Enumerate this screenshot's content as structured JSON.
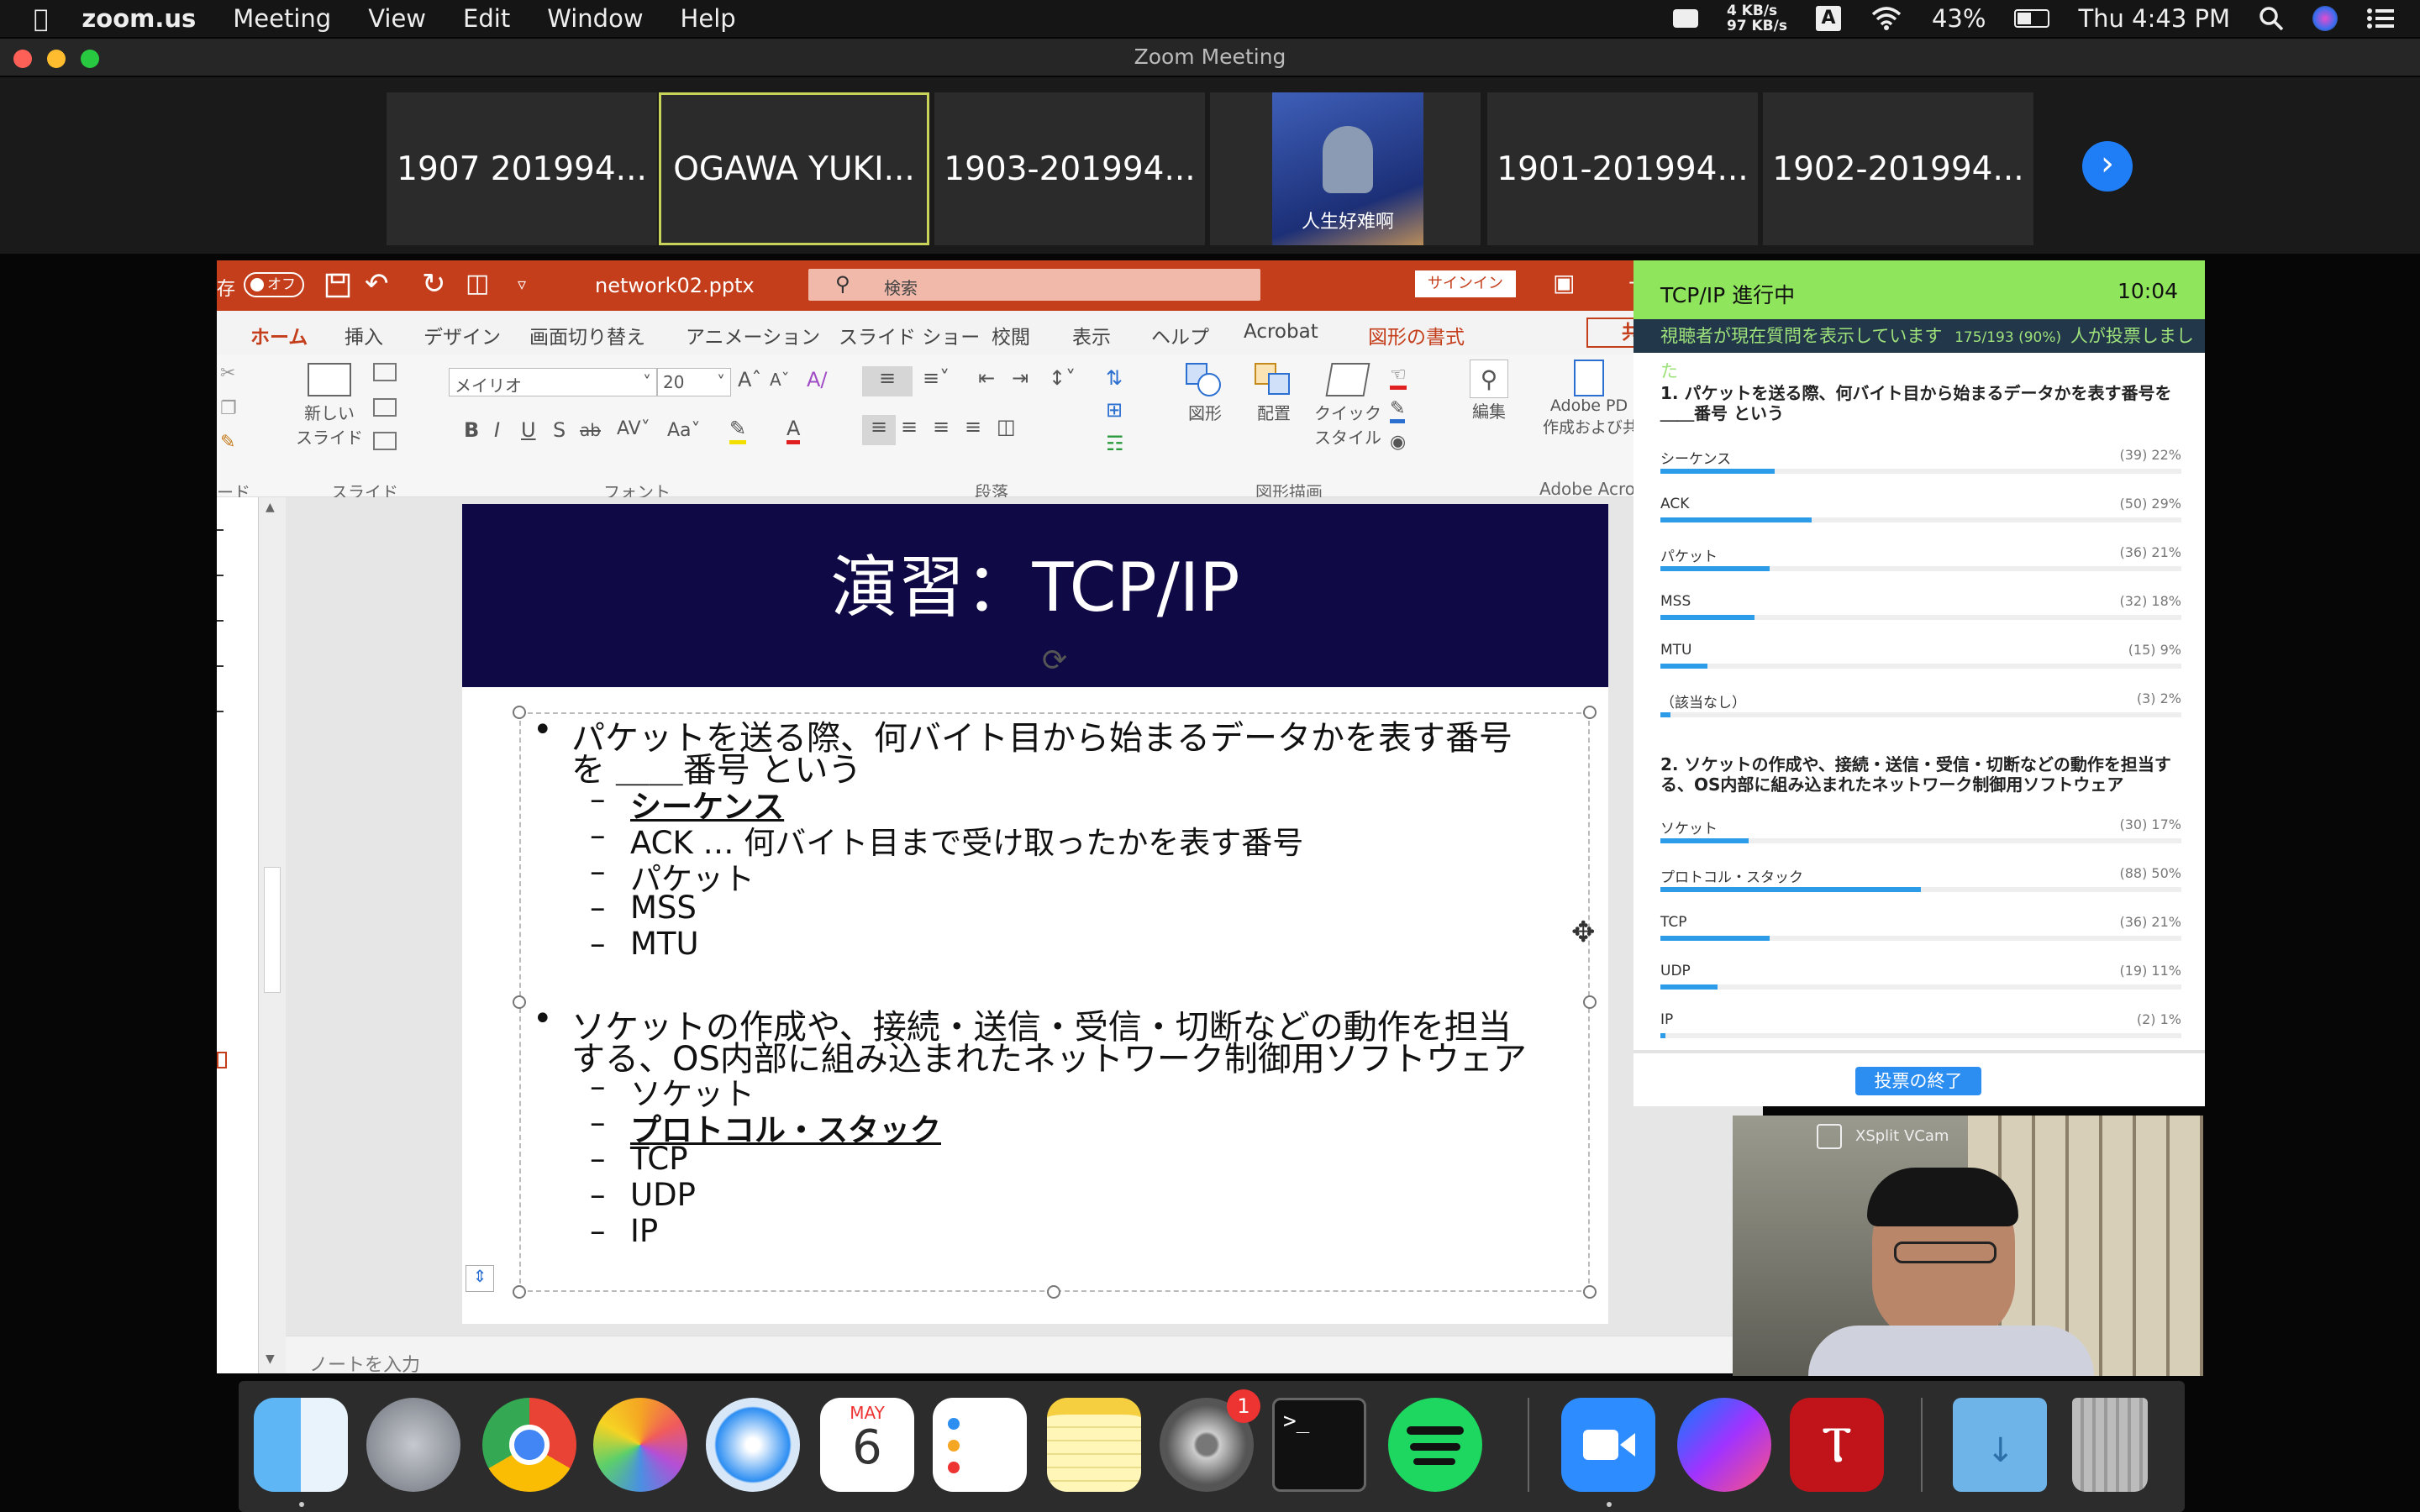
{
  "menubar": {
    "app": "zoom.us",
    "items": [
      "Meeting",
      "View",
      "Edit",
      "Window",
      "Help"
    ],
    "net_up": "4 KB/s",
    "net_down": "97 KB/s",
    "battery": "43%",
    "clock": "Thu 4:43 PM"
  },
  "window": {
    "title": "Zoom Meeting"
  },
  "gallery": {
    "tiles": [
      "1907 201994...",
      "OGAWA YUKI...",
      "1903-201994...",
      "1901-201994...",
      "1902-201994..."
    ],
    "video_caption": "人生好难啊"
  },
  "ppt": {
    "autosave_label": "存",
    "autosave_state": "オフ",
    "filename": "network02.pptx",
    "search_placeholder": "検索",
    "signin": "サインイン",
    "share": "共",
    "tabs": [
      "ホーム",
      "挿入",
      "デザイン",
      "画面切り替え",
      "アニメーション",
      "スライド ショー",
      "校閲",
      "表示",
      "ヘルプ",
      "Acrobat",
      "図形の書式"
    ],
    "font_name": "メイリオ",
    "font_size": "20",
    "groups": [
      "スライド",
      "フォント",
      "段落",
      "図形描画",
      "Adobe Acro"
    ],
    "new_slide": "新しい",
    "new_slide2": "スライド",
    "shape": "図形",
    "arrange": "配置",
    "quick": "クイック",
    "quick2": "スタイル",
    "edit": "編集",
    "adobe": "Adobe PD",
    "adobe2": "作成および共",
    "slide_label": "ード",
    "notes_placeholder": "ノートを入力",
    "slide": {
      "title": "演習：TCP/IP",
      "b1_l1": "パケットを送る際、何バイト目から始まるデータかを表す番号",
      "b1_l2": "を ＿＿番号 という",
      "b1_subs": [
        "シーケンス",
        "ACK … 何バイト目まで受け取ったかを表す番号",
        "パケット",
        "MSS",
        "MTU"
      ],
      "b2_l1": "ソケットの作成や、接続・送信・受信・切断などの動作を担当",
      "b2_l2": "する、OS内部に組み込まれたネットワーク制御用ソフトウェア",
      "b2_subs": [
        "ソケット",
        "プロトコル・スタック",
        "TCP",
        "UDP",
        "IP"
      ],
      "dash": "–",
      "bullet": "•"
    }
  },
  "poll": {
    "title": "TCP/IP 進行中",
    "timer": "10:04",
    "status": "視聴者が現在質問を表示しています",
    "count": "175/193 (90%)",
    "voted": "人が投票しました",
    "q1": "1. パケットを送る際、何バイト目から始まるデータかを表す番号を＿＿番号 という",
    "q1_options": [
      {
        "name": "シーケンス",
        "stat": "(39) 22%",
        "pct": 22
      },
      {
        "name": "ACK",
        "stat": "(50) 29%",
        "pct": 29
      },
      {
        "name": "パケット",
        "stat": "(36) 21%",
        "pct": 21
      },
      {
        "name": "MSS",
        "stat": "(32) 18%",
        "pct": 18
      },
      {
        "name": "MTU",
        "stat": "(15) 9%",
        "pct": 9
      },
      {
        "name": "（該当なし）",
        "stat": "(3) 2%",
        "pct": 2
      }
    ],
    "q2": "2. ソケットの作成や、接続・送信・受信・切断などの動作を担当する、OS内部に組み込まれたネットワーク制御用ソフトウェア",
    "q2_options": [
      {
        "name": "ソケット",
        "stat": "(30) 17%",
        "pct": 17
      },
      {
        "name": "プロトコル・スタック",
        "stat": "(88) 50%",
        "pct": 50
      },
      {
        "name": "TCP",
        "stat": "(36) 21%",
        "pct": 21
      },
      {
        "name": "UDP",
        "stat": "(19) 11%",
        "pct": 11
      },
      {
        "name": "IP",
        "stat": "(2) 1%",
        "pct": 1
      }
    ],
    "end_button": "投票の終了"
  },
  "webcam": {
    "label": "XSplit VCam"
  },
  "dock": {
    "calendar_month": "MAY",
    "calendar_day": "6",
    "badge": "1"
  }
}
